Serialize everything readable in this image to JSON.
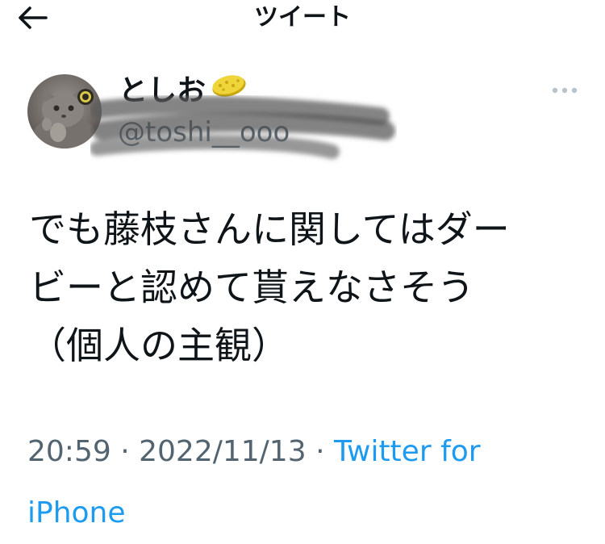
{
  "header": {
    "title": "ツイート",
    "back_icon": "arrow-left-icon"
  },
  "tweet": {
    "author": {
      "display_name": "としお",
      "handle": "@toshi__ooo",
      "badge_icon": "yellow-sponge-emoji-icon",
      "avatar_icon": "cat-avatar-icon"
    },
    "more_icon": "more-horizontal-icon",
    "text": "でも藤枝さんに関してはダー\nビーと認めて貰えなさそう\n（個人の主観）",
    "time": "20:59",
    "separator": "·",
    "date": "2022/11/13",
    "source": "Twitter for iPhone"
  },
  "colors": {
    "text_primary": "#0f1419",
    "text_secondary": "#536471",
    "link": "#1d9bf0"
  }
}
